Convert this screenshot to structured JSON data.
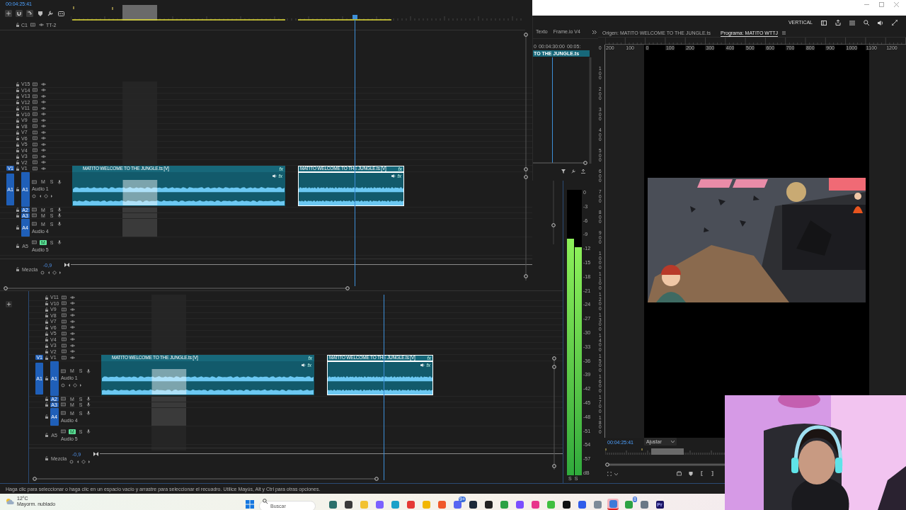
{
  "timelines": [
    {
      "timecode": "00:04:25:41",
      "header_track": {
        "name": "C1",
        "label": "TT-2"
      },
      "video_tracks": [
        {
          "name": "V15"
        },
        {
          "name": "V14"
        },
        {
          "name": "V13"
        },
        {
          "name": "V12"
        },
        {
          "name": "V11"
        },
        {
          "name": "V10"
        },
        {
          "name": "V9"
        },
        {
          "name": "V8"
        },
        {
          "name": "V7"
        },
        {
          "name": "V6"
        },
        {
          "name": "V5"
        },
        {
          "name": "V4"
        },
        {
          "name": "V3"
        },
        {
          "name": "V2"
        },
        {
          "name": "V1",
          "source": "V1"
        }
      ],
      "audio_tracks": [
        {
          "name": "A1",
          "source": "A1",
          "targeted": true,
          "label": "Audio 1",
          "keyframes": true,
          "mute": "M",
          "solo": "S",
          "muted": false
        },
        {
          "name": "A2",
          "targeted": true,
          "keyframes": false,
          "mute": "M",
          "solo": "S",
          "muted": false
        },
        {
          "name": "A3",
          "targeted": true,
          "keyframes": false,
          "mute": "M",
          "solo": "S",
          "muted": false
        },
        {
          "name": "A4",
          "targeted": true,
          "label": "Audio 4",
          "keyframes": false,
          "mute": "M",
          "solo": "S",
          "muted": false
        },
        {
          "name": "A5",
          "targeted": false,
          "label": "Audio 5",
          "keyframes": false,
          "mute": "M",
          "solo": "S",
          "muted": true
        }
      ],
      "mix": {
        "label": "Mezcla",
        "value": "-0,9"
      },
      "clips": [
        {
          "title": "MATITO WELCOME TO THE JUNGLE.ts [V]",
          "video_fx": "fx",
          "audio_fx": "fx",
          "selected": false
        },
        {
          "title": "MATITO WELCOME TO THE JUNGLE.ts [V]",
          "video_fx": "fx",
          "audio_fx": "fx",
          "selected": true
        }
      ]
    },
    {
      "video_tracks": [
        {
          "name": "V11"
        },
        {
          "name": "V10"
        },
        {
          "name": "V9"
        },
        {
          "name": "V8"
        },
        {
          "name": "V7"
        },
        {
          "name": "V6"
        },
        {
          "name": "V5"
        },
        {
          "name": "V4"
        },
        {
          "name": "V3"
        },
        {
          "name": "V2"
        },
        {
          "name": "V1",
          "source": "V1"
        }
      ],
      "audio_tracks": [
        {
          "name": "A1",
          "source": "A1",
          "targeted": true,
          "label": "Audio 1",
          "keyframes": true,
          "mute": "M",
          "solo": "S",
          "muted": false
        },
        {
          "name": "A2",
          "targeted": true,
          "keyframes": false,
          "mute": "M",
          "solo": "S",
          "muted": false
        },
        {
          "name": "A3",
          "targeted": true,
          "keyframes": false,
          "mute": "M",
          "solo": "S",
          "muted": false
        },
        {
          "name": "A4",
          "targeted": true,
          "label": "Audio 4",
          "keyframes": false,
          "mute": "M",
          "solo": "S",
          "muted": false
        },
        {
          "name": "A5",
          "targeted": false,
          "label": "Audio 5",
          "keyframes": false,
          "mute": "M",
          "solo": "S",
          "muted": true
        }
      ],
      "mix": {
        "label": "Mezcla",
        "value": "-0,9"
      },
      "clips": [
        {
          "title": "MATITO WELCOME TO THE JUNGLE.ts [V]",
          "video_fx": "fx",
          "audio_fx": "fx",
          "selected": false
        },
        {
          "title": "MATITO WELCOME TO THE JUNGLE.ts [V]",
          "video_fx": "fx",
          "audio_fx": "fx",
          "selected": true
        }
      ]
    }
  ],
  "side_panel": {
    "tabs": [
      "Texto",
      "Frame.io V4"
    ],
    "ruler": [
      "0",
      "00:04:30:00",
      "00:05:"
    ],
    "clip": "TO THE JUNGLE.ts"
  },
  "program": {
    "toolbar_label": "VERTICAL",
    "tabs": [
      {
        "label": "Origen: MATITO WELCOME TO THE JUNGLE.ts",
        "selected": false
      },
      {
        "label": "Programa: MATITO WTTJ",
        "selected": true
      }
    ],
    "h_ruler": [
      "200",
      "100",
      "0",
      "100",
      "200",
      "300",
      "400",
      "500",
      "600",
      "700",
      "800",
      "900",
      "1000",
      "1100",
      "1200"
    ],
    "v_ruler": [
      "0",
      "100",
      "200",
      "300",
      "400",
      "500",
      "600",
      "700",
      "800",
      "900",
      "1000",
      "1100",
      "1200",
      "1300",
      "1400",
      "1500",
      "1600",
      "1700",
      "1800"
    ],
    "timecode": "00:04:25:41",
    "fit": "Ajustar"
  },
  "meter": {
    "scale": [
      "0",
      "-3",
      "-6",
      "-9",
      "-12",
      "-15",
      "-18",
      "-21",
      "-24",
      "-27",
      "-30",
      "-33",
      "-36",
      "-39",
      "-42",
      "-45",
      "-48",
      "-51",
      "-54",
      "-57",
      "dB"
    ],
    "channels": [
      {
        "level": 0.83,
        "label": "S"
      },
      {
        "level": 0.8,
        "label": "S"
      }
    ]
  },
  "status_bar": "Haga clic para seleccionar o haga clic en un espacio vacío y arrastre para seleccionar el recuadro. Utilice Mayús, Alt y Ctrl para otras opciones.",
  "taskbar": {
    "temperature": "12°C",
    "weather": "Mayorm. nublado",
    "search_placeholder": "Buscar",
    "apps": [
      {
        "color": "#2b6f6a",
        "selected": false
      },
      {
        "color": "#3a3a3a",
        "selected": false
      },
      {
        "color": "#f2c230",
        "selected": false
      },
      {
        "color": "#7b61ff",
        "selected": false
      },
      {
        "color": "#1aa1c9",
        "selected": false
      },
      {
        "color": "#e53935",
        "selected": false
      },
      {
        "color": "#f2b600",
        "selected": false
      },
      {
        "color": "#f0582a",
        "selected": false
      },
      {
        "color": "#5865f2",
        "badge": "9+",
        "selected": false
      },
      {
        "color": "#1b2838",
        "selected": false
      },
      {
        "color": "#222222",
        "selected": false
      },
      {
        "color": "#2ca243",
        "selected": false
      },
      {
        "color": "#7a4dff",
        "selected": false
      },
      {
        "color": "#e8358b",
        "selected": false
      },
      {
        "color": "#3fbf3f",
        "selected": false
      },
      {
        "color": "#111111",
        "selected": false
      },
      {
        "color": "#2f5bea",
        "selected": false
      },
      {
        "color": "#7d8a99",
        "selected": false
      },
      {
        "color": "#3c7bd9",
        "selected": true
      },
      {
        "color": "#2ca243",
        "badge": "8",
        "selected": false
      },
      {
        "color": "#6b7785",
        "selected": false
      },
      {
        "color": "#1b1464",
        "label": "Pr",
        "selected": false
      }
    ]
  }
}
